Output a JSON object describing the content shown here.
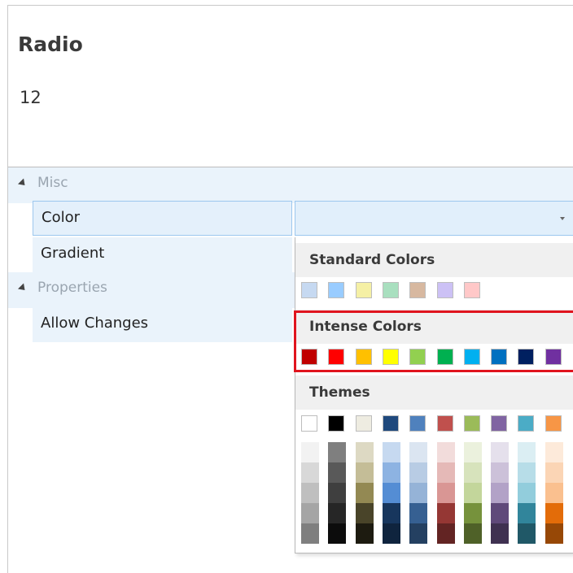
{
  "header": {
    "title": "Radio",
    "value": "12"
  },
  "grid": {
    "categories": [
      {
        "label": "Misc"
      },
      {
        "label": "Properties"
      }
    ],
    "misc_items": [
      {
        "name": "Color",
        "value": "",
        "selected": true
      },
      {
        "name": "Gradient",
        "value": ""
      }
    ],
    "properties_items": [
      {
        "name": "Allow Changes",
        "value": ""
      }
    ]
  },
  "color_picker": {
    "standard_title": "Standard Colors",
    "standard_colors": [
      "#c6d9f1",
      "#99ccff",
      "#f5f0a5",
      "#a9dfbf",
      "#d7b8a0",
      "#ccc1f5",
      "#ffc8c8"
    ],
    "intense_title": "Intense Colors",
    "intense_colors": [
      "#c00000",
      "#ff0000",
      "#ffc000",
      "#ffff00",
      "#92d050",
      "#00b050",
      "#00b0f0",
      "#0070c0",
      "#002060",
      "#7030a0"
    ],
    "themes_title": "Themes",
    "theme_base": [
      "#ffffff",
      "#000000",
      "#eeece1",
      "#1f497d",
      "#4f81bd",
      "#c0504d",
      "#9bbb59",
      "#8064a2",
      "#4bacc6",
      "#f79646"
    ],
    "theme_shades": [
      [
        "#f2f2f2",
        "#d8d8d8",
        "#bfbfbf",
        "#a5a5a5",
        "#7f7f7f"
      ],
      [
        "#7f7f7f",
        "#595959",
        "#3f3f3f",
        "#262626",
        "#0c0c0c"
      ],
      [
        "#ddd9c3",
        "#c4bd97",
        "#938953",
        "#494429",
        "#1d1b10"
      ],
      [
        "#c6d9f0",
        "#8db3e2",
        "#548dd4",
        "#17365d",
        "#0f243e"
      ],
      [
        "#dbe5f1",
        "#b8cce4",
        "#95b3d7",
        "#366092",
        "#244061"
      ],
      [
        "#f2dcdb",
        "#e5b9b7",
        "#d99694",
        "#953734",
        "#632423"
      ],
      [
        "#ebf1dd",
        "#d7e3bc",
        "#c3d69b",
        "#76923c",
        "#4f6128"
      ],
      [
        "#e5e0ec",
        "#ccc1d9",
        "#b2a2c7",
        "#5f497a",
        "#3f3151"
      ],
      [
        "#dbeef3",
        "#b7dde8",
        "#92cddc",
        "#31859b",
        "#205867"
      ],
      [
        "#fdeada",
        "#fbd5b5",
        "#fac08f",
        "#e36c09",
        "#974806"
      ]
    ]
  }
}
